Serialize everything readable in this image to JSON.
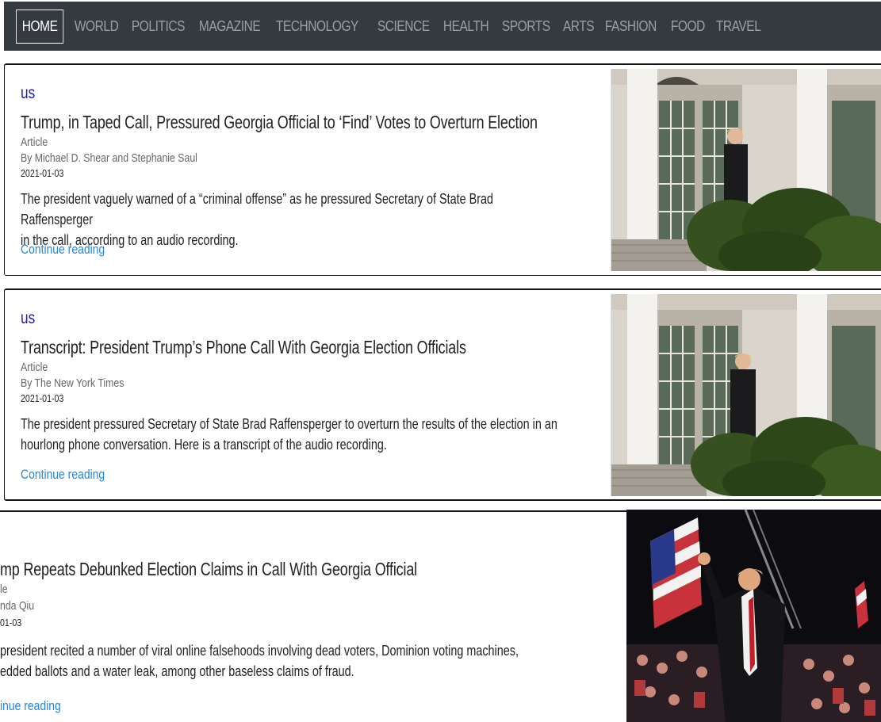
{
  "nav": {
    "items": [
      "HOME",
      "WORLD",
      "POLITICS",
      "MAGAZINE",
      "TECHNOLOGY",
      "SCIENCE",
      "HEALTH",
      "SPORTS",
      "ARTS",
      "FASHION",
      "FOOD",
      "TRAVEL"
    ],
    "active": "HOME"
  },
  "articles": [
    {
      "section": "us",
      "headline": "Trump, in Taped Call, Pressured Georgia Official to ‘Find’ Votes to Overturn Election",
      "type": "Article",
      "byline": "By Michael D. Shear and Stephanie Saul",
      "date": "2021-01-03",
      "abstract_line1": "The president vaguely warned of a “criminal offense” as he pressured Secretary of State Brad Raffensperger",
      "abstract_line2": "in the call, according to an audio recording.",
      "link": "Continue reading"
    },
    {
      "section": "us",
      "headline": "Transcript: President Trump’s Phone Call With Georgia Election Officials",
      "type": "Article",
      "byline": "By The New York Times",
      "date": "2021-01-03",
      "abstract_line1": "The president pressured Secretary of State Brad Raffensperger to overturn the results of the election in an",
      "abstract_line2": "hourlong phone conversation. Here is a transcript of the audio recording.",
      "link": "Continue reading"
    },
    {
      "headline": "mp Repeats Debunked Election Claims in Call With Georgia Official",
      "type": "le",
      "byline": "nda Qiu",
      "date": "01-03",
      "abstract_line1": "president recited a number of viral online falsehoods involving dead voters, Dominion voting machines,",
      "abstract_line2": "edded ballots and a water leak, among other baseless claims of fraud.",
      "link": "inue reading"
    }
  ]
}
